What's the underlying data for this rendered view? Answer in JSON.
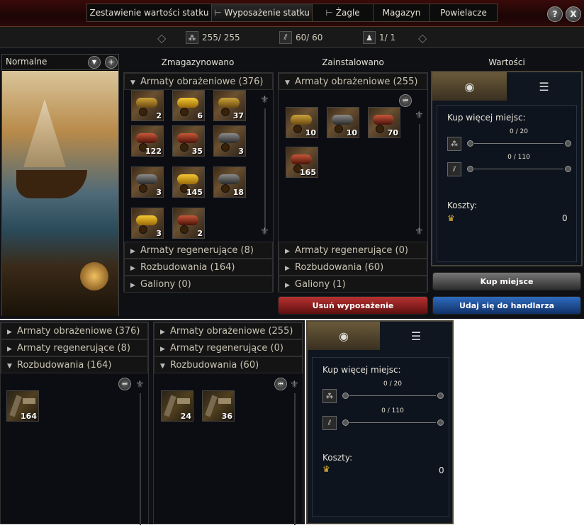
{
  "tabs": {
    "items": [
      {
        "label": "Zestawienie wartości statku"
      },
      {
        "label": "Wyposażenie statku"
      },
      {
        "label": "Żagle"
      },
      {
        "label": "Magazyn"
      },
      {
        "label": "Powielacze"
      }
    ],
    "help_label": "?",
    "close_label": "X"
  },
  "stats": {
    "slots": "255/ 255",
    "upgrades": "60/ 60",
    "figureheads": "1/ 1"
  },
  "left": {
    "dropdown_value": "Normalne",
    "add_label": "+"
  },
  "headers": {
    "stored": "Zmagazynowano",
    "installed": "Zainstalowano",
    "values": "Wartości"
  },
  "stored": {
    "expanded_category": "Armaty obrażeniowe (376)",
    "counts": [
      "2",
      "6",
      "37",
      "122",
      "35",
      "3",
      "3",
      "145",
      "18",
      "3",
      "2"
    ],
    "categories": [
      "Armaty regenerujące (8)",
      "Rozbudowania (164)",
      "Galiony (0)"
    ]
  },
  "installed": {
    "expanded_category": "Armaty obrażeniowe (255)",
    "counts": [
      "10",
      "10",
      "70",
      "165"
    ],
    "categories": [
      "Armaty regenerujące (0)",
      "Rozbudowania (60)",
      "Galiony (1)"
    ]
  },
  "values_panel": {
    "buy_more": "Kup więcej miejsc:",
    "slider1": "0 / 20",
    "slider2": "0 / 110",
    "costs_label": "Koszty:",
    "costs_value": "0",
    "buy_button": "Kup miejsce",
    "trader_button": "Udaj się do handlarza"
  },
  "remove_button": "Usuń wyposażenie",
  "lower_stored": {
    "categories": [
      "Armaty obrażeniowe (376)",
      "Armaty regenerujące (8)",
      "Rozbudowania (164)"
    ],
    "counts": [
      "164"
    ]
  },
  "lower_installed": {
    "categories": [
      "Armaty obrażeniowe (255)",
      "Armaty regenerujące (0)",
      "Rozbudowania (60)"
    ],
    "counts": [
      "24",
      "36"
    ]
  },
  "lower_values": {
    "buy_more": "Kup więcej miejsc:",
    "slider1": "0 / 20",
    "slider2": "0 / 110",
    "costs_label": "Koszty:",
    "costs_value": "0"
  }
}
